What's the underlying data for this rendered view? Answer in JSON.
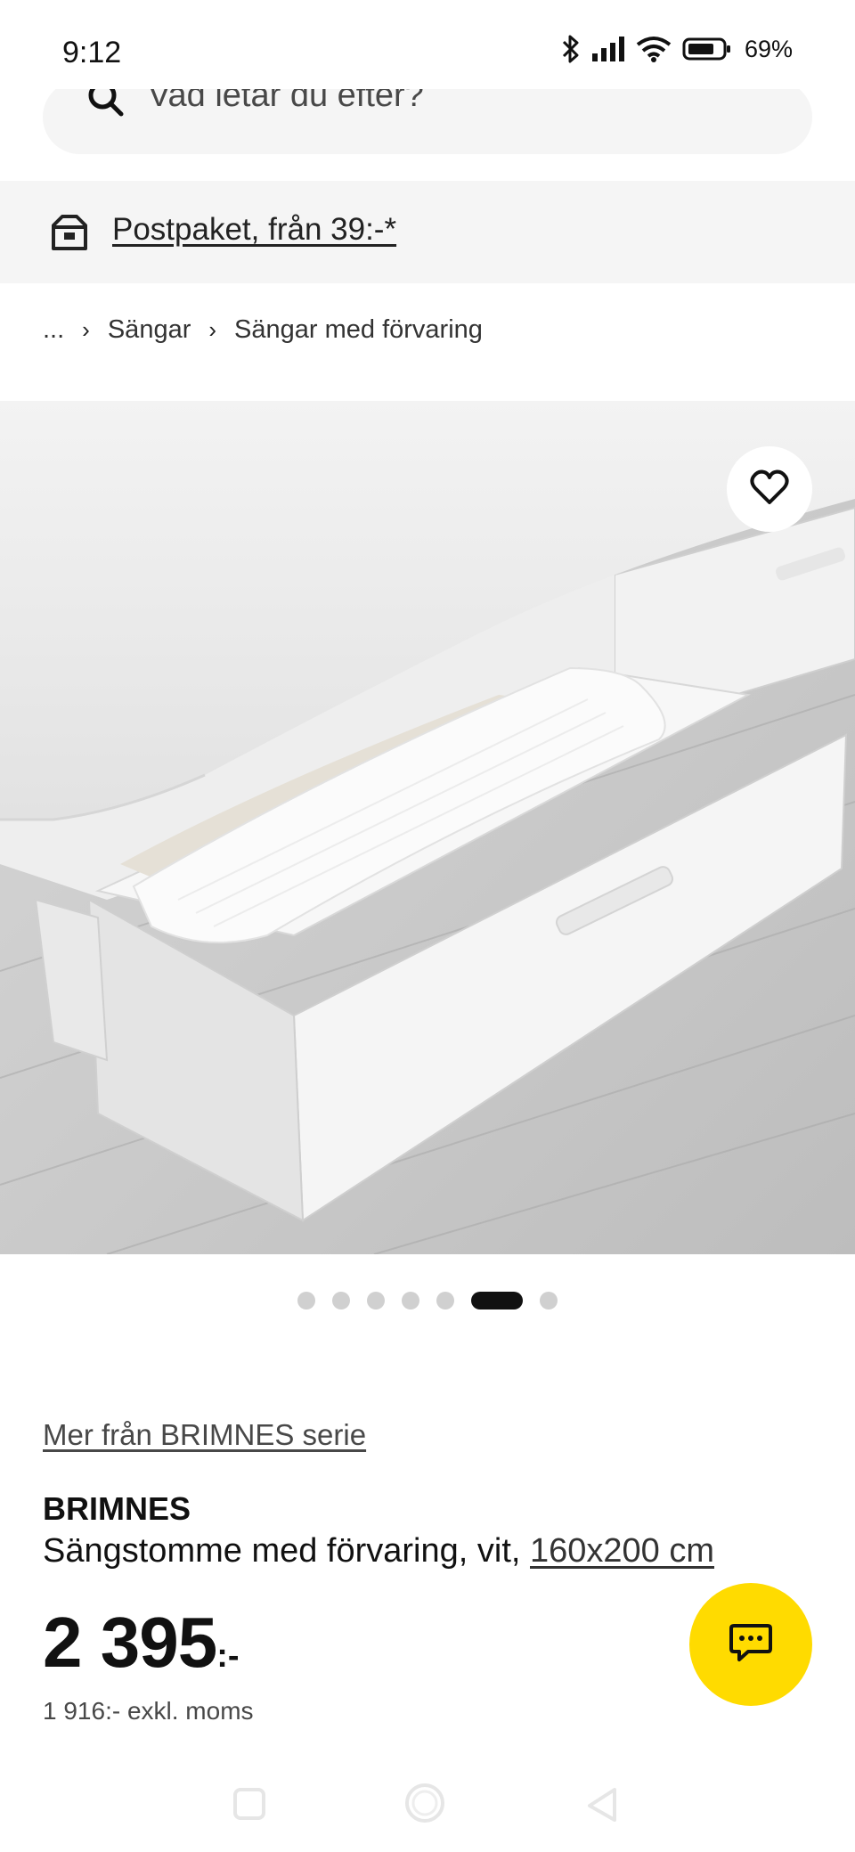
{
  "status_bar": {
    "time": "9:12",
    "battery": "69%",
    "icons": [
      "bluetooth-icon",
      "signal-icon",
      "wifi-icon",
      "battery-icon"
    ]
  },
  "search": {
    "placeholder": "Vad letar du efter?",
    "icon": "search-icon"
  },
  "promo": {
    "icon": "package-icon",
    "text": "Postpaket, från 39:-*"
  },
  "breadcrumb": {
    "ellipsis": "...",
    "items": [
      "Sängar",
      "Sängar med förvaring"
    ],
    "separator_icon": "chevron-right-icon"
  },
  "gallery": {
    "image_count": 7,
    "active_index": 5,
    "favorite_icon": "heart-outline-icon"
  },
  "product": {
    "series_link": "Mer från BRIMNES serie",
    "name": "BRIMNES",
    "description": "Sängstomme med förvaring, vit, ",
    "size": "160x200 cm",
    "price_integer": "2 395",
    "price_suffix": ":-",
    "price_excl_vat": "1 916:- exkl. moms"
  },
  "chat": {
    "icon": "chat-bubble-icon",
    "color": "#ffdb00"
  },
  "nav_bar": {
    "buttons": [
      "recents-square-icon",
      "home-circle-icon",
      "back-triangle-icon"
    ]
  },
  "colors": {
    "accent_yellow": "#ffdb00",
    "promo_background": "#f5f5f5",
    "text_primary": "#111111",
    "text_secondary": "#484848"
  }
}
